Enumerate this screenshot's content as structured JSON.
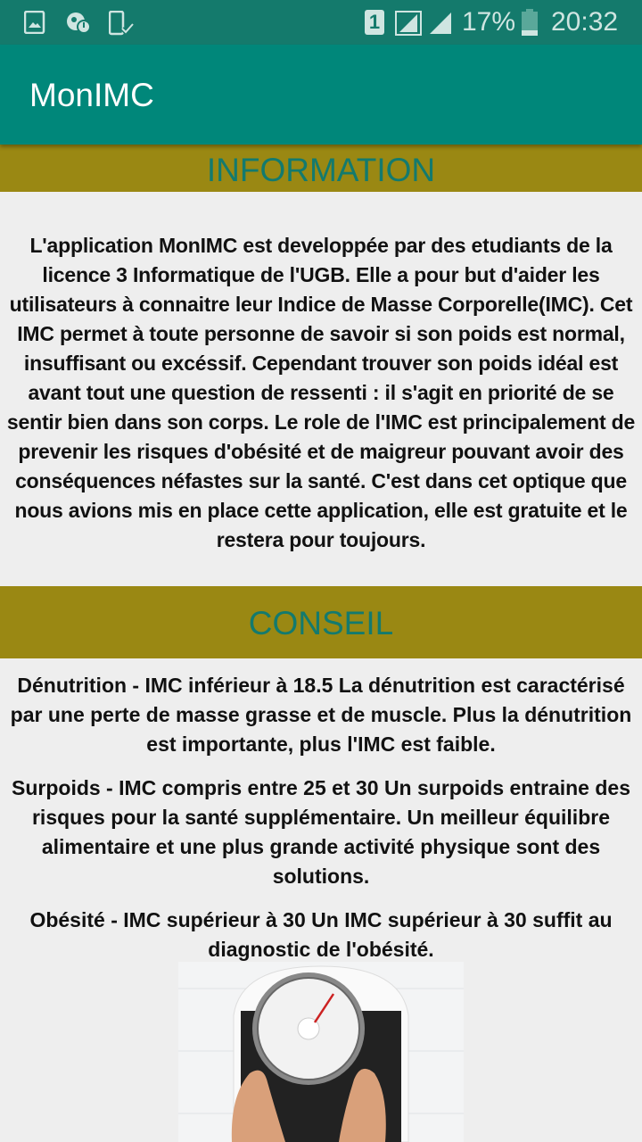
{
  "status_bar": {
    "battery": "17%",
    "time": "20:32",
    "sim": "1"
  },
  "app_bar": {
    "title": "MonIMC"
  },
  "information": {
    "heading": "INFORMATION",
    "text": "L'application MonIMC est developpée par des etudiants de la licence 3 Informatique de l'UGB. Elle a pour but d'aider les utilisateurs à connaitre leur Indice de Masse Corporelle(IMC). Cet IMC permet à toute personne de savoir si son poids est normal, insuffisant ou excéssif. Cependant trouver son poids idéal est avant tout une question de ressenti : il s'agit en priorité de se sentir bien dans son corps. Le role de l'IMC est principalement de prevenir les risques d'obésité et de maigreur pouvant avoir des conséquences néfastes sur la santé. C'est dans cet optique que nous avions mis en place cette application, elle est gratuite et le restera pour toujours."
  },
  "conseil": {
    "heading": "CONSEIL",
    "items": [
      "Dénutrition - IMC inférieur à 18.5 La dénutrition est caractérisé par une perte de masse grasse et de muscle. Plus la dénutrition est importante, plus l'IMC est faible.",
      "Surpoids - IMC compris entre 25 et 30 Un surpoids entraine des risques pour la santé supplémentaire. Un meilleur équilibre alimentaire et une plus grande activité physique sont des solutions.",
      "Obésité - IMC supérieur à 30 Un IMC supérieur à 30 suffit au diagnostic de l'obésité."
    ]
  }
}
